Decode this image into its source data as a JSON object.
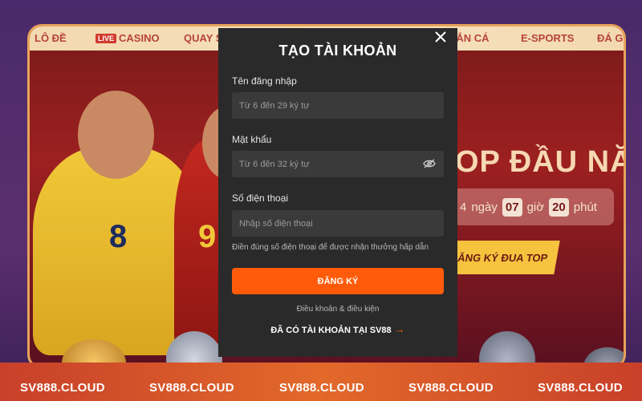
{
  "nav": {
    "items": [
      {
        "label": "LÔ ĐỀ"
      },
      {
        "label": "CASINO",
        "badge": "LIVE"
      },
      {
        "label": "QUAY SỐ"
      },
      {
        "label": "BẮN CÁ"
      },
      {
        "label": "E-SPORTS"
      },
      {
        "label": "ĐÁ GÀ"
      }
    ]
  },
  "banner": {
    "title": "OP ĐẦU NĂM",
    "countdown": {
      "days_value": "4",
      "days_label": "ngày",
      "hours_value": "07",
      "hours_label": "giờ",
      "minutes_value": "20",
      "minutes_label": "phút"
    },
    "cta_label": "ĂNG KÝ ĐUA TOP",
    "jersey_numbers": [
      "8",
      "9"
    ]
  },
  "modal": {
    "title": "TẠO TÀI KHOẢN",
    "username": {
      "label": "Tên đăng nhập",
      "placeholder": "Từ 6 đến 29 ký tự"
    },
    "password": {
      "label": "Mật khẩu",
      "placeholder": "Từ 6 đến 32 ký tự"
    },
    "phone": {
      "label": "Số điện thoại",
      "placeholder": "Nhập số điện thoại",
      "hint": "Điền đúng số điện thoại để được nhận thưởng hấp dẫn"
    },
    "submit_label": "ĐĂNG KÝ",
    "terms_label": "Điều khoản & điều kiện",
    "login_link_label": "ĐÃ CÓ TÀI KHOẢN TẠI SV88",
    "icons": {
      "close": "close-icon",
      "eye": "eye-icon",
      "arrow": "arrow-right-icon"
    }
  },
  "footer": {
    "items": [
      "SV888.CLOUD",
      "SV888.CLOUD",
      "SV888.CLOUD",
      "SV888.CLOUD",
      "SV888.CLOUD"
    ]
  },
  "colors": {
    "accent": "#ff5b0a",
    "modal_bg": "#2a2a2a",
    "field_bg": "#3a3a3a"
  }
}
